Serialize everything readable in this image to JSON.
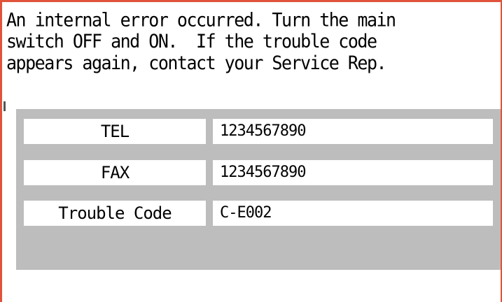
{
  "message": {
    "lines": [
      "An internal error occurred. Turn the main",
      "switch OFF and ON.  If the trouble code",
      "appears again, contact your Service Rep."
    ]
  },
  "contact_table": {
    "rows": [
      {
        "label": "TEL",
        "value": "1234567890"
      },
      {
        "label": "FAX",
        "value": "1234567890"
      },
      {
        "label": "Trouble Code",
        "value": "C-E002"
      }
    ]
  },
  "colors": {
    "frame_border": "#e0533a",
    "panel_background": "#bdbdbd",
    "cell_background": "#ffffff",
    "text": "#000000"
  }
}
